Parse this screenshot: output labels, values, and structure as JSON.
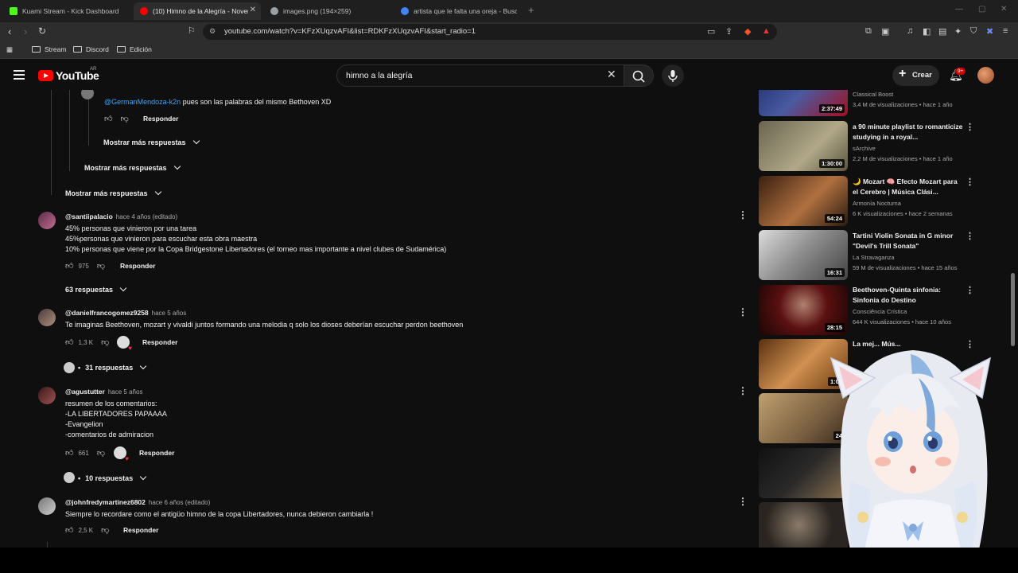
{
  "browser": {
    "tabs": [
      {
        "label": "Kuami Stream - Kick Dashboard",
        "color": "#53fc18"
      },
      {
        "label": "(10) Himno de la Alegría - Novena",
        "color": "#ff0000"
      },
      {
        "label": "images.png (194×259)",
        "color": "#9aa0a6"
      },
      {
        "label": "artista que le falta una oreja - Buscar",
        "color": "#4285f4"
      }
    ],
    "url": "youtube.com/watch?v=KFzXUqzvAFI&list=RDKFzXUqzvAFI&start_radio=1",
    "bookmarks": [
      "Stream",
      "Discord",
      "Edición"
    ]
  },
  "youtube": {
    "logo": "YouTube",
    "region": "AR",
    "search_query": "himno a la alegría",
    "create_label": "Crear",
    "notif_badge": "9+"
  },
  "comments": {
    "nested_reply_text": "pues son las palabras del mismo Bethoven XD",
    "nested_reply_mention": "@GermanMendoza-k2n",
    "reply_label": "Responder",
    "show_more_1": "Mostrar más respuestas",
    "show_more_2": "Mostrar más respuestas",
    "show_more_3": "Mostrar más respuestas",
    "items": [
      {
        "author": "@santiipalacio",
        "time": "hace 4 años (editado)",
        "lines": [
          "45% personas que vinieron por una tarea",
          "45%personas que vinieron para escuchar esta obra maestra",
          "10% personas que viene por la Copa Bridgestone Libertadores (el torneo mas importante a nivel clubes de Sudamérica)"
        ],
        "likes": "975",
        "replies": "63 respuestas"
      },
      {
        "author": "@danielfrancogomez9258",
        "time": "hace 5 años",
        "lines": [
          "Te imaginas Beethoven, mozart y vivaldi juntos formando una melodia q solo los dioses deberían escuchar perdon beethoven"
        ],
        "likes": "1,3 K",
        "replies": "31 respuestas"
      },
      {
        "author": "@agustutter",
        "time": "hace 5 años",
        "lines": [
          "resumen de los comentarios:",
          "-LA LIBERTADORES PAPAAAA",
          "-Evangelion",
          "-comentarios de admiracion"
        ],
        "likes": "661",
        "replies": "10 respuestas"
      },
      {
        "author": "@johnfredymartinez6802",
        "time": "hace 6 años (editado)",
        "lines": [
          "Siempre lo recordare como el antigüo himno de la copa Libertadores, nunca debieron cambiarla !"
        ],
        "likes": "2,5 K",
        "replies": ""
      }
    ]
  },
  "sidebar": {
    "videos": [
      {
        "title": "",
        "channel": "Classical Boost",
        "meta": "3,4 M de visualizaciones • hace 1 año",
        "duration": "2:37:49",
        "color": "#2a3a7a"
      },
      {
        "title": "a 90 minute playlist to romanticize studying in a royal...",
        "channel": "sArchive",
        "meta": "2,2 M de visualizaciones • hace 1 año",
        "duration": "1:30:00",
        "color": "#8a8570"
      },
      {
        "title": "🌙 Mozart 🧠 Efecto Mozart para el Cerebro | Música Clási...",
        "channel": "Armonía Nocturna",
        "meta": "6 K visualizaciones • hace 2 semanas",
        "duration": "54:24",
        "color": "#7a4a2a"
      },
      {
        "title": "Tartini Violin Sonata in G minor \"Devil's Trill Sonata\"",
        "channel": "La Stravaganza",
        "meta": "59 M de visualizaciones • hace 15 años",
        "duration": "16:31",
        "color": "#9a9a9a"
      },
      {
        "title": "Beethoven-Quinta sinfonia: Sinfonia do Destino",
        "channel": "Consciência Crística",
        "meta": "644 K visualizaciones • hace 10 años",
        "duration": "28:15",
        "color": "#3a1010"
      },
      {
        "title": "La mej... Mús...",
        "channel": "",
        "meta": "",
        "duration": "1:04",
        "color": "#8a5a2a"
      },
      {
        "title": "",
        "channel": "",
        "meta": "",
        "duration": "24",
        "color": "#a08a60"
      },
      {
        "title": "",
        "channel": "",
        "meta": "",
        "duration": "",
        "color": "#1a1a1a"
      },
      {
        "title": "",
        "channel": "",
        "meta": "",
        "duration": "",
        "color": "#2a2520"
      }
    ]
  }
}
